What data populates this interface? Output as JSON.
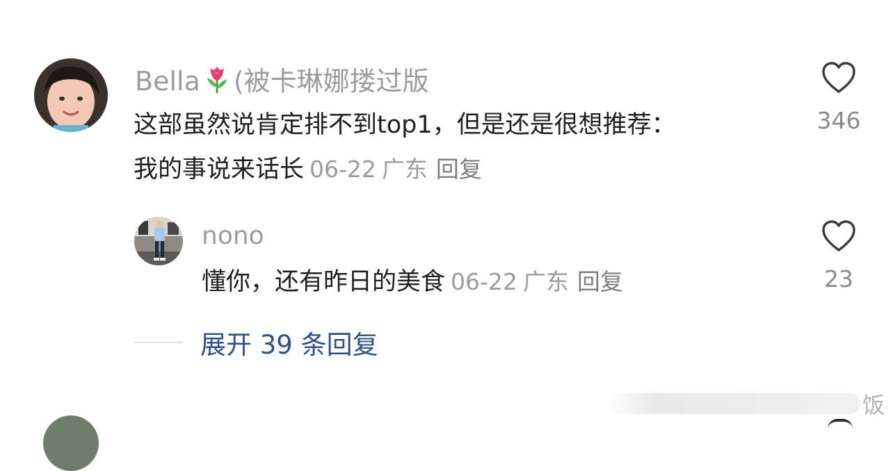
{
  "comment": {
    "username": "Bella",
    "username_suffix": "(被卡琳娜搂过版",
    "username_emoji": "tulip-icon",
    "text_line1": "这部虽然说肯定排不到top1，但是还是很想推荐：",
    "text_line2": "我的事说来话长",
    "date": "06-22",
    "location": "广东",
    "reply_label": "回复",
    "likes": "346"
  },
  "reply": {
    "username": "nono",
    "text": "懂你，还有昨日的美食",
    "date": "06-22",
    "location": "广东",
    "reply_label": "回复",
    "likes": "23"
  },
  "expand": {
    "label": "展开 39 条回复"
  },
  "watermark": {
    "text": "饭"
  },
  "colors": {
    "username": "#9b9b9b",
    "body_text": "#1f1f1f",
    "meta": "#9b9b9b",
    "link": "#304f83",
    "tulip": "#e0406a"
  }
}
